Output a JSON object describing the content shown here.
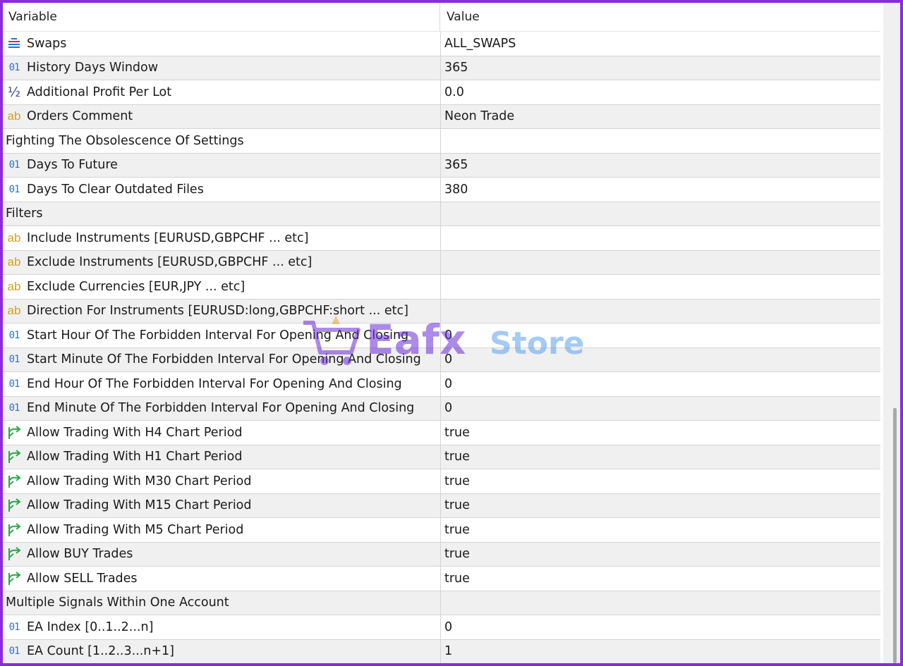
{
  "header": {
    "variable_label": "Variable",
    "value_label": "Value"
  },
  "rows": [
    {
      "type": "enum",
      "icon": "enum-icon",
      "label": "Swaps",
      "value": "ALL_SWAPS"
    },
    {
      "type": "int",
      "icon": "int-icon",
      "icon_text": "01",
      "label": "History Days Window",
      "value": "365"
    },
    {
      "type": "dbl",
      "icon": "double-icon",
      "icon_text": "½",
      "label": "Additional Profit Per Lot",
      "value": "0.0"
    },
    {
      "type": "str",
      "icon": "string-icon",
      "icon_text": "ab",
      "label": "Orders Comment",
      "value": "Neon Trade"
    },
    {
      "type": "group",
      "label": "Fighting The Obsolescence Of Settings",
      "value": ""
    },
    {
      "type": "int",
      "icon": "int-icon",
      "icon_text": "01",
      "label": "Days To Future",
      "value": "365"
    },
    {
      "type": "int",
      "icon": "int-icon",
      "icon_text": "01",
      "label": "Days To Clear Outdated Files",
      "value": "380"
    },
    {
      "type": "group",
      "label": "Filters",
      "value": ""
    },
    {
      "type": "str",
      "icon": "string-icon",
      "icon_text": "ab",
      "label": "Include Instruments [EURUSD,GBPCHF ... etc]",
      "value": ""
    },
    {
      "type": "str",
      "icon": "string-icon",
      "icon_text": "ab",
      "label": "Exclude Instruments [EURUSD,GBPCHF ... etc]",
      "value": ""
    },
    {
      "type": "str",
      "icon": "string-icon",
      "icon_text": "ab",
      "label": "Exclude Currencies [EUR,JPY ... etc]",
      "value": ""
    },
    {
      "type": "str",
      "icon": "string-icon",
      "icon_text": "ab",
      "label": "Direction For Instruments [EURUSD:long,GBPCHF:short ... etc]",
      "value": ""
    },
    {
      "type": "int",
      "icon": "int-icon",
      "icon_text": "01",
      "label": "Start Hour Of The Forbidden Interval For Opening And Closing",
      "value": "0"
    },
    {
      "type": "int",
      "icon": "int-icon",
      "icon_text": "01",
      "label": "Start Minute Of The Forbidden Interval For Opening And Closing",
      "value": "0"
    },
    {
      "type": "int",
      "icon": "int-icon",
      "icon_text": "01",
      "label": "End Hour Of The Forbidden Interval For Opening And Closing",
      "value": "0"
    },
    {
      "type": "int",
      "icon": "int-icon",
      "icon_text": "01",
      "label": "End Minute Of The Forbidden Interval For Opening And Closing",
      "value": "0"
    },
    {
      "type": "bool",
      "icon": "bool-icon",
      "label": "Allow Trading With H4 Chart Period",
      "value": "true"
    },
    {
      "type": "bool",
      "icon": "bool-icon",
      "label": "Allow Trading With H1 Chart Period",
      "value": "true"
    },
    {
      "type": "bool",
      "icon": "bool-icon",
      "label": "Allow Trading With M30 Chart Period",
      "value": "true"
    },
    {
      "type": "bool",
      "icon": "bool-icon",
      "label": "Allow Trading With M15 Chart Period",
      "value": "true"
    },
    {
      "type": "bool",
      "icon": "bool-icon",
      "label": "Allow Trading With M5 Chart Period",
      "value": "true"
    },
    {
      "type": "bool",
      "icon": "bool-icon",
      "label": "Allow BUY Trades",
      "value": "true"
    },
    {
      "type": "bool",
      "icon": "bool-icon",
      "label": "Allow SELL Trades",
      "value": "true"
    },
    {
      "type": "group",
      "label": "Multiple Signals Within One Account",
      "value": ""
    },
    {
      "type": "int",
      "icon": "int-icon",
      "icon_text": "01",
      "label": "EA Index [0..1..2...n]",
      "value": "0"
    },
    {
      "type": "int",
      "icon": "int-icon",
      "icon_text": "01",
      "label": "EA Count [1..2..3...n+1]",
      "value": "1"
    }
  ],
  "watermark": {
    "text_a": "Eafx",
    "text_b": "Store"
  },
  "colors": {
    "border": "#8a2be2",
    "int_icon": "#2a73c8",
    "str_icon": "#d4a01e",
    "bool_icon": "#2aa84a"
  }
}
